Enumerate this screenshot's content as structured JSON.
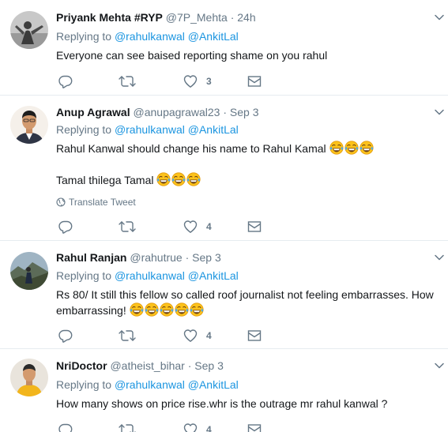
{
  "tweets": [
    {
      "name": "Priyank Mehta #RYP",
      "handle": "@7P_Mehta",
      "time": "24h",
      "replying_label": "Replying to",
      "mentions": [
        "@rahulkanwal",
        "@AnkitLal"
      ],
      "text": "Everyone can see baised reporting shame on you rahul",
      "text2": "",
      "like_count": "3"
    },
    {
      "name": "Anup Agrawal",
      "handle": "@anupagrawal23",
      "time": "Sep 3",
      "replying_label": "Replying to",
      "mentions": [
        "@rahulkanwal",
        "@AnkitLal"
      ],
      "text": "Rahul Kanwal should change his name to Rahul Kamal",
      "text2": "Tamal thilega Tamal",
      "translate": "Translate Tweet",
      "like_count": "4"
    },
    {
      "name": "Rahul Ranjan",
      "handle": "@rahutrue",
      "time": "Sep 3",
      "replying_label": "Replying to",
      "mentions": [
        "@rahulkanwal",
        "@AnkitLal"
      ],
      "text": "Rs 80/ It still this fellow so called roof journalist not feeling embarrasses. How embarrassing!",
      "like_count": "4"
    },
    {
      "name": "NriDoctor",
      "handle": "@atheist_bihar",
      "time": "Sep 3",
      "replying_label": "Replying to",
      "mentions": [
        "@rahulkanwal",
        "@AnkitLal"
      ],
      "text": "How many shows on price rise.whr is the outrage mr rahul kanwal ?",
      "like_count": "4"
    }
  ],
  "separator": "·",
  "icons": {
    "reply": "reply-icon",
    "retweet": "retweet-icon",
    "like": "heart-icon",
    "dm": "envelope-icon",
    "caret": "chevron-down-icon",
    "globe": "globe-icon",
    "emoji": "face-with-tears-of-joy-emoji"
  },
  "colors": {
    "name": "#14171a",
    "muted": "#657786",
    "mention": "#1b95e0",
    "divider": "#e6ecf0"
  }
}
